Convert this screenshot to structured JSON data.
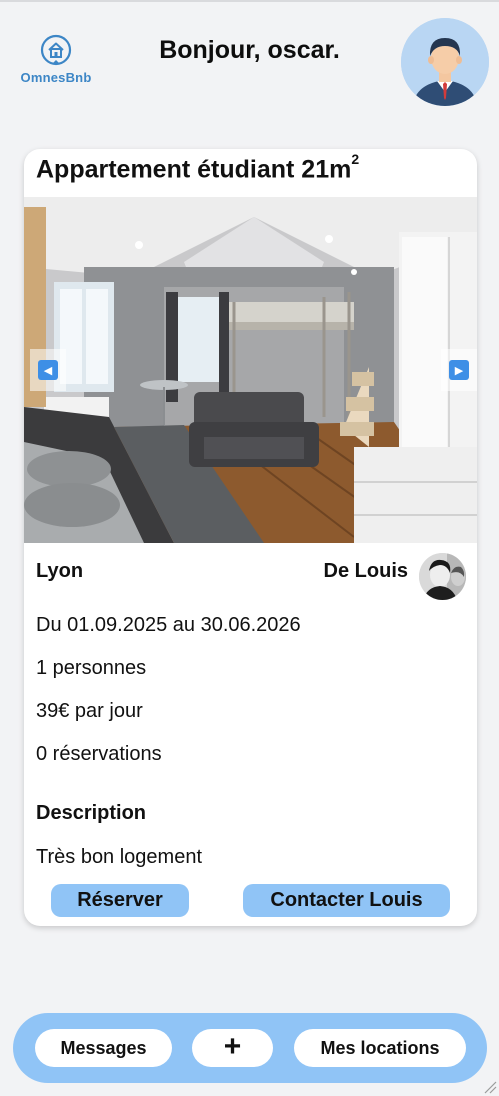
{
  "header": {
    "logo_text": "OmnesBnb",
    "greeting": "Bonjour, oscar."
  },
  "listing": {
    "title": "Appartement étudiant 21m",
    "title_sup": "2",
    "city": "Lyon",
    "owner": "De Louis",
    "dates": "Du 01.09.2025 au 30.06.2026",
    "persons": "1 personnes",
    "price": "39€ par jour",
    "reservations": "0 réservations",
    "description_title": "Description",
    "description": "Très bon logement",
    "reserve_label": "Réserver",
    "contact_label": "Contacter Louis"
  },
  "bottom_nav": {
    "messages_label": "Messages",
    "add_label": "+",
    "locations_label": "Mes locations"
  },
  "colors": {
    "accent": "#90c4f6",
    "background": "#f2f3f5",
    "logo": "#3d86c6"
  },
  "icons": {
    "logo": "house-logo-icon",
    "prev": "arrow-left-icon",
    "next": "arrow-right-icon"
  }
}
